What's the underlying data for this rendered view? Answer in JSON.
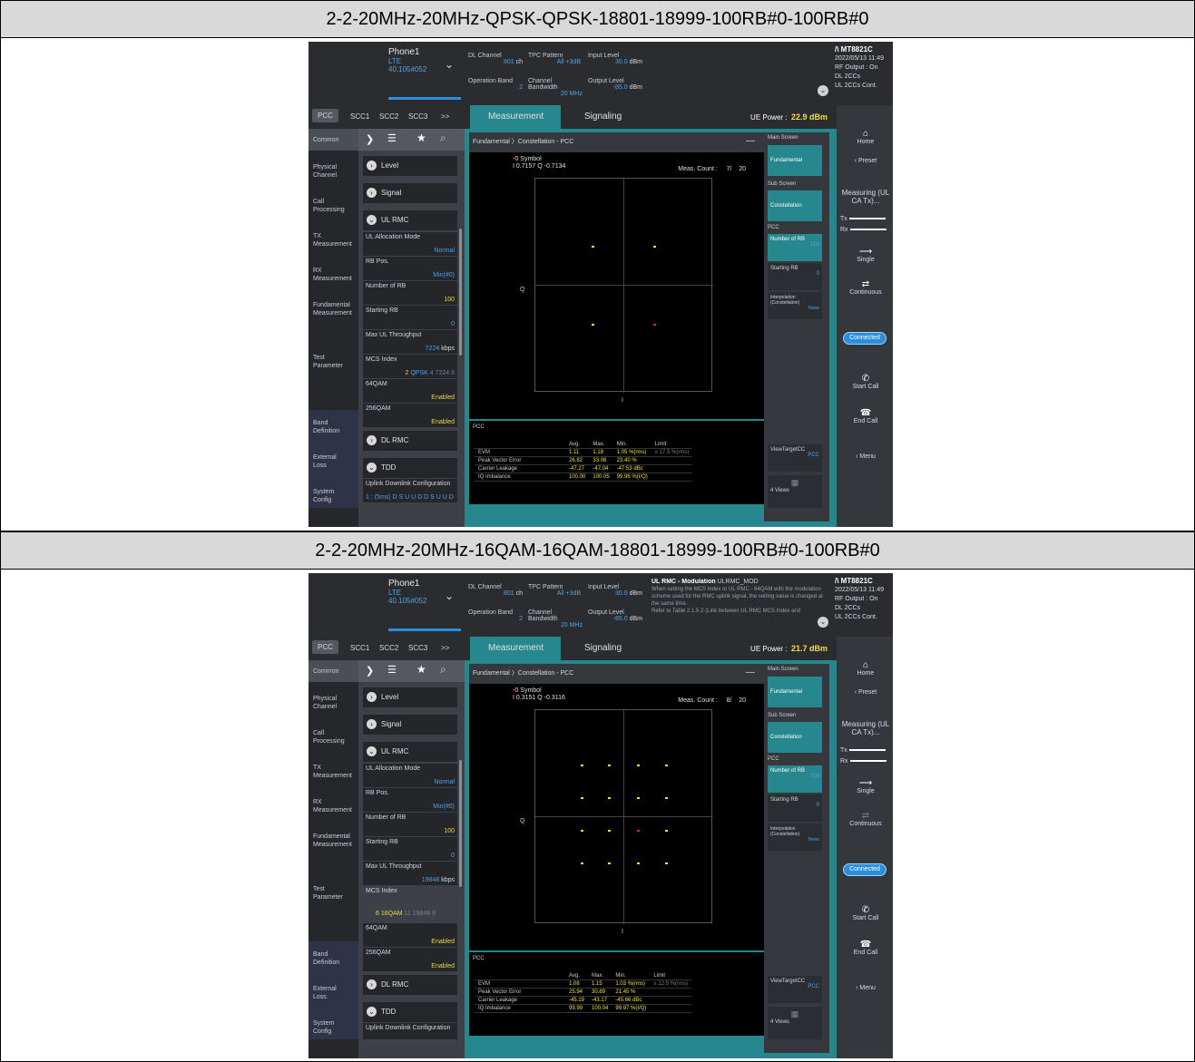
{
  "doc": {
    "header1": "2-2-20MHz-20MHz-QPSK-QPSK-18801-18999-100RB#0-100RB#0",
    "header2": "2-2-20MHz-20MHz-16QAM-16QAM-18801-18999-100RB#0-100RB#0"
  },
  "common": {
    "phone": "Phone1",
    "rat": "LTE",
    "version": "40.105#052",
    "lbl_dl_channel": "DL Channel",
    "lbl_tpc": "TPC Pattern",
    "lbl_input": "Input Level",
    "lbl_opband": "Operation Band",
    "lbl_bw": "Channel Bandwidth",
    "lbl_output": "Output Level",
    "dl_channel": "801",
    "dl_unit": "ch",
    "tpc": "All +3dB",
    "input": "30.0",
    "dbm": "dBm",
    "opband": "2",
    "bw": "20 MHz",
    "output": "-85.0",
    "brand": "MT8821C",
    "date": "2022/05/13 11:49",
    "rf": "RF Output : On",
    "dl_cc": "DL 2CCs",
    "ul_cc": "UL 2CCs Cont.",
    "tabs": [
      "PCC",
      "SCC1",
      "SCC2",
      "SCC3",
      ">>"
    ],
    "nav": [
      "Common",
      "Physical Channel",
      "Call Processing",
      "TX Measurement",
      "RX Measurement",
      "Fundamental Measurement",
      "Test Parameter",
      "Band Definition",
      "External Loss",
      "System Config"
    ],
    "level": "Level",
    "signal": "Signal",
    "ulrmc": "UL RMC",
    "ul_alloc": "UL Allocation Mode",
    "ul_alloc_v": "Normal",
    "rbpos": "RB Pos.",
    "rbpos_v": "Min(#0)",
    "nrb": "Number of RB",
    "nrb_v": "100",
    "srb": "Starting RB",
    "srb_v": "0",
    "maxthr": "Max UL Throughput",
    "kbps": "kbps",
    "mcs": "MCS Index",
    "q64": "64QAM",
    "q256": "256QAM",
    "enabled": "Enabled",
    "dlrmc": "DL RMC",
    "tdd": "TDD",
    "uldl": "Uplink Downlink Configuration",
    "mt_meas": "Measurement",
    "mt_sig": "Signaling",
    "uep": "UE Power :",
    "ptitle": "Fundamental 〉Constellation - PCC",
    "symbol": "0 Symbol",
    "meas_count": "Meas. Count :",
    "q_axis": "Q",
    "i_axis": "I",
    "main_screen": "Main Screen",
    "fundamental": "Fundamental",
    "sub_screen": "Sub Screen",
    "constellation": "Constellation",
    "pcc": "PCC",
    "interp": "Interpolation (Constellation)",
    "none": "None",
    "viewtarget": "ViewTargetCC",
    "views": "4 Views",
    "col_avg": "Avg.",
    "col_max": "Max.",
    "col_min": "Min.",
    "col_limit": "Limit",
    "r_evm": "EVM",
    "r_pve": "Peak Vector Error",
    "r_cl": "Carrier Leakage",
    "r_iq": "IQ Imbalance",
    "home": "Home",
    "preset": "Preset",
    "measuring": "Measuring (UL CA Tx)...",
    "tx": "Tx",
    "rx": "Rx",
    "single": "Single",
    "continuous": "Continuous",
    "connected": "Connected",
    "startcall": "Start Call",
    "endcall": "End Call",
    "menu": "Menu"
  },
  "shot1": {
    "uep_v": "22.9 dBm",
    "iq": "I 0.7157 Q -0.7134",
    "count": "7/",
    "count_total": "20",
    "thr_v": "7224",
    "mcs_v": "2",
    "mcs_mod": "QPSK",
    "mcs_rest": "4 7224 8",
    "uldl_v": "1 : (5ms) D S U U D D S U U D",
    "evm": [
      "1.11",
      "1.18",
      "1.05 %(rms)",
      "≤ 17.5 %(rms)"
    ],
    "pve": [
      "26.82",
      "33.08",
      "23.40 %"
    ],
    "cl": [
      "-47.27",
      "-47.04",
      "-47.53 dBc"
    ],
    "iqr": [
      "100.00",
      "100.05",
      "99.96 %(I/Q)"
    ]
  },
  "shot2": {
    "uep_v": "21.7 dBm",
    "iq": "I 0.3151 Q -0.3116",
    "count": "8/",
    "count_total": "20",
    "thr_v": "19848",
    "mcs_v": "6",
    "mcs_mod": "16QAM",
    "mcs_rest": "11 19848 8",
    "tip_title": "UL RMC - Modulation",
    "tip_code": "ULRMC_MOD",
    "tip_text": "When setting the MCS Index or UL RMC - 64QAM with the modulation scheme used for the RMC uplink signal, the setting value is changed at the same time.",
    "tip_more": "Refer to Table 2.1.5-2 (Link between UL RMC MCS Index and",
    "evm": [
      "1.08",
      "1.15",
      "1.03 %(rms)",
      "≤ 12.5 %(rms)"
    ],
    "pve": [
      "25.94",
      "30.89",
      "21.45 %"
    ],
    "cl": [
      "-45.19",
      "-43.17",
      "-45.66 dBc"
    ],
    "iqr": [
      "99.99",
      "100.04",
      "99.97 %(I/Q)"
    ]
  },
  "colors": {
    "accent": "#26878f",
    "value_blue": "#4ea3e8",
    "value_yellow": "#f0e040"
  }
}
